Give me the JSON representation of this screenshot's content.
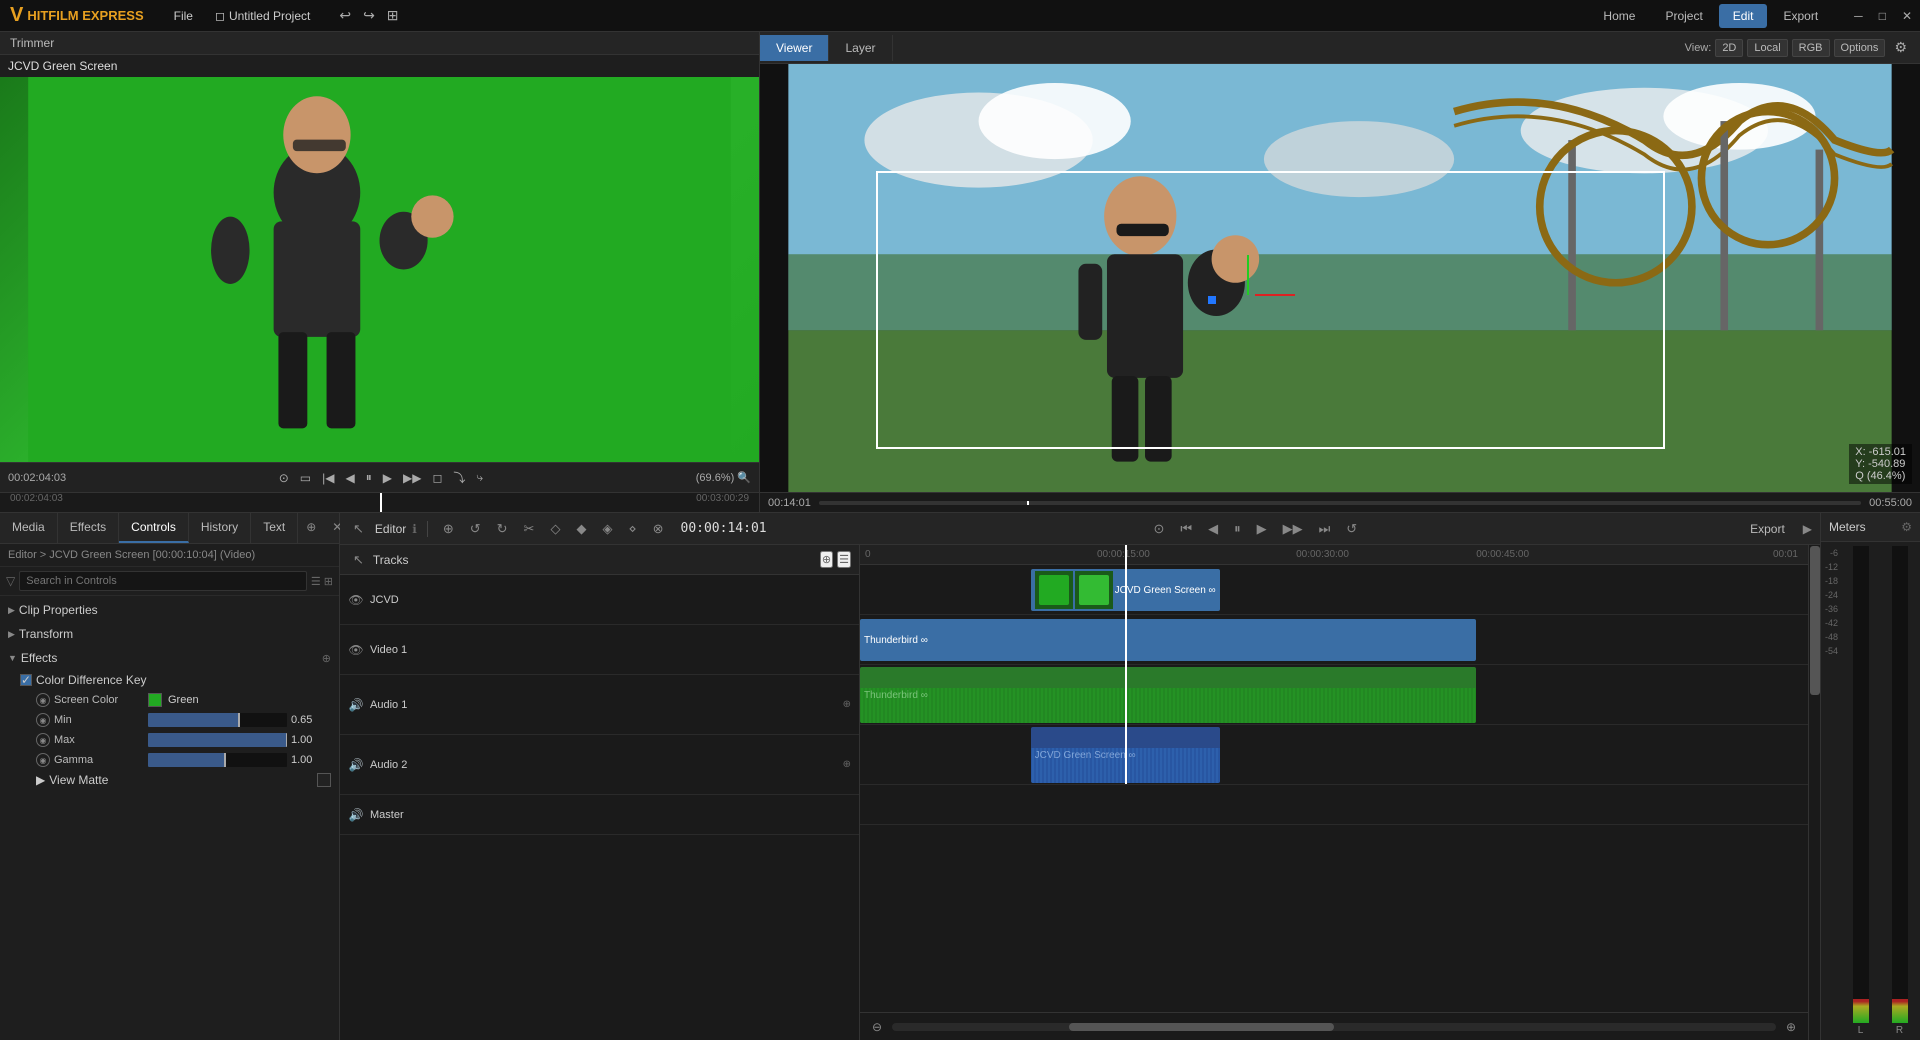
{
  "topbar": {
    "logo_text": "HITFILM EXPRESS",
    "menu_items": [
      "File",
      "Untitled Project"
    ],
    "project_name": "Untitled Project",
    "nav_items": [
      "Home",
      "Project",
      "Edit",
      "Export"
    ],
    "active_nav": "Edit"
  },
  "trimmer": {
    "title": "Trimmer",
    "clip_name": "JCVD Green Screen",
    "time_display": "00:02:04:03",
    "time_end": "00:03:00:29",
    "zoom_label": "(69.6%)"
  },
  "viewer": {
    "tabs": [
      "Viewer",
      "Layer"
    ],
    "active_tab": "Viewer",
    "view_mode": "2D",
    "color_space": "Local",
    "channels": "RGB",
    "options_label": "Options",
    "coords": "X: -615.01\nY: -540.89",
    "zoom_label": "Q (46.4%)",
    "time_start": "00:14:01",
    "time_end": "00:55:00"
  },
  "left_panel": {
    "tabs": [
      "Media",
      "Effects",
      "Controls",
      "History",
      "Text"
    ],
    "active_tab": "Controls",
    "breadcrumb": "Editor > JCVD Green Screen [00:00:10:04] (Video)",
    "search_placeholder": "Search in Controls",
    "sections": {
      "clip_properties": "Clip Properties",
      "transform": "Transform",
      "effects": "Effects"
    },
    "effect_name": "Color Difference Key",
    "properties": {
      "screen_color_label": "Screen Color",
      "screen_color_value": "Green",
      "min_label": "Min",
      "min_value": "0.65",
      "max_label": "Max",
      "max_value": "1.00",
      "gamma_label": "Gamma",
      "gamma_value": "1.00",
      "view_matte_label": "View Matte"
    }
  },
  "editor": {
    "title": "Editor",
    "timecode": "00:00:14:01",
    "export_label": "Export",
    "tracks_label": "Tracks",
    "tracks": [
      {
        "name": "JCVD",
        "type": "video_composite",
        "icon": "eye"
      },
      {
        "name": "Video 1",
        "type": "video",
        "icon": "eye"
      },
      {
        "name": "Audio 1",
        "type": "audio",
        "icon": "speaker"
      },
      {
        "name": "Audio 2",
        "type": "audio",
        "icon": "speaker"
      },
      {
        "name": "Master",
        "type": "master",
        "icon": "speaker"
      }
    ],
    "timeline_marks": [
      "0",
      "00:00:15:00",
      "00:00:30:00",
      "00:00:45:00",
      "00:01"
    ],
    "clips": [
      {
        "track": "JCVD",
        "label": "JCVD Green Screen",
        "color": "blue",
        "start_pct": 18,
        "width_pct": 19
      },
      {
        "track": "Video 1",
        "label": "Thunderbird",
        "color": "blue",
        "start_pct": 0,
        "width_pct": 65
      },
      {
        "track": "Audio 1",
        "label": "Thunderbird",
        "color": "green",
        "start_pct": 0,
        "width_pct": 65
      },
      {
        "track": "Audio 2",
        "label": "JCVD Green Screen",
        "color": "blue-audio",
        "start_pct": 18,
        "width_pct": 19
      }
    ]
  },
  "meters": {
    "title": "Meters",
    "scale": [
      "-6",
      "-12",
      "-18",
      "-24",
      "-36",
      "-42",
      "-48",
      "-54"
    ]
  },
  "icons": {
    "play": "▶",
    "pause": "⏸",
    "stop": "■",
    "rewind": "⏮",
    "forward": "⏭",
    "undo": "↩",
    "redo": "↪",
    "eye": "👁",
    "settings": "⚙",
    "search": "🔍",
    "chevron_right": "▶",
    "chevron_down": "▼",
    "close": "✕",
    "minimize": "─",
    "maximize": "□"
  }
}
